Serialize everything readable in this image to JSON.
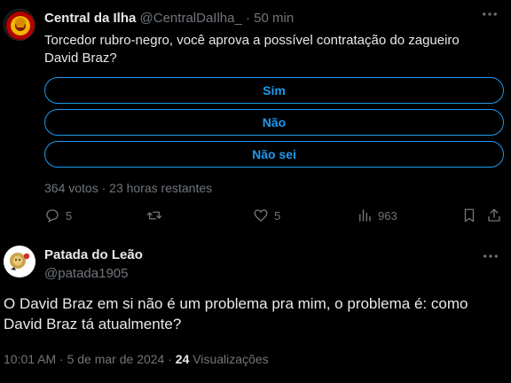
{
  "tweet": {
    "author_name": "Central da Ilha",
    "handle": "@CentralDaIlha_",
    "separator": "·",
    "time": "50 min",
    "text": "Torcedor rubro-negro, você aprova a possível contratação do zagueiro David Braz?",
    "poll": {
      "options": [
        "Sim",
        "Não",
        "Não sei"
      ],
      "votes": "364 votos",
      "separator": "·",
      "remaining": "23 horas restantes"
    },
    "actions": {
      "replies": "5",
      "retweets": "",
      "likes": "5",
      "views": "963"
    },
    "icons": {
      "reply": "comment-icon",
      "retweet": "retweet-icon",
      "like": "heart-icon",
      "views": "views-icon",
      "bookmark": "bookmark-icon",
      "share": "share-icon",
      "more": "more-icon"
    }
  },
  "reply": {
    "author_name": "Patada do Leão",
    "handle": "@patada1905",
    "text": "O David Braz em si não é um problema pra mim, o problema é: como David Braz tá atualmente?",
    "timestamp": "10:01 AM · 5 de mar de 2024",
    "separator": "·",
    "views_count": "24",
    "views_label": "Visualizações"
  },
  "colors": {
    "background": "#000000",
    "text": "#e7e9ea",
    "muted": "#71767b",
    "accent": "#1d9bf0"
  }
}
